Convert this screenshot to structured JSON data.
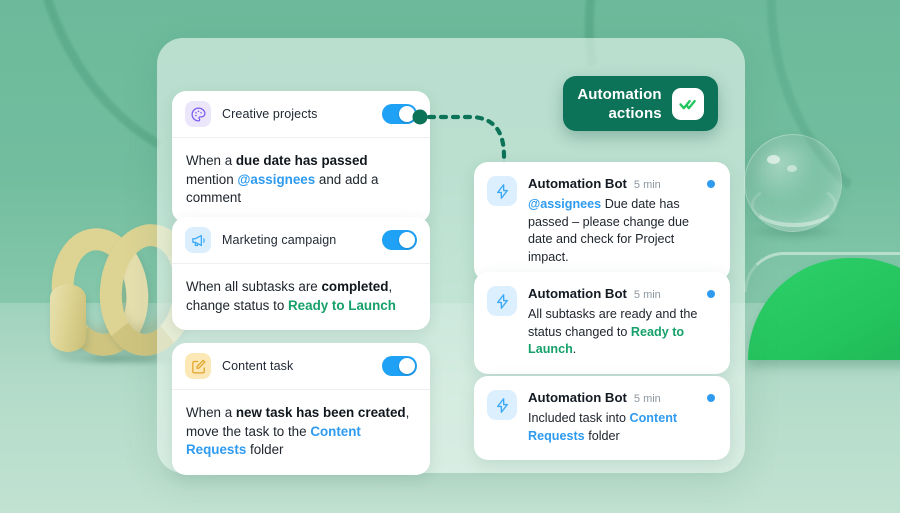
{
  "scene": {
    "background_color": "#6dbb9c",
    "panel_color": "rgba(233,245,239,0.62)"
  },
  "badge": {
    "line1": "Automation",
    "line2": "actions",
    "icon": "double-check-icon",
    "bg_color": "#0d7358",
    "check_color": "#22c55e"
  },
  "connector": {
    "style": "dotted-curve-with-arrow",
    "color": "#0d7358"
  },
  "rules": [
    {
      "id": "creative-projects",
      "title": "Creative projects",
      "icon": "palette-icon",
      "icon_color": "#7c5cf0",
      "icon_bg": "#ece6fb",
      "toggle_on": true,
      "body": {
        "seg1": "When a ",
        "bold1": "due date has passed",
        "seg2": " mention ",
        "link1": "@assignees",
        "seg3": " and add a comment"
      }
    },
    {
      "id": "marketing-campaign",
      "title": "Marketing campaign",
      "icon": "megaphone-icon",
      "icon_color": "#3aa8f5",
      "icon_bg": "#daeefd",
      "toggle_on": true,
      "body": {
        "seg1": "When all subtasks are ",
        "bold1": "completed",
        "seg2": ", change status to ",
        "link1": "Ready to Launch",
        "seg3": ""
      }
    },
    {
      "id": "content-task",
      "title": "Content task",
      "icon": "edit-square-icon",
      "icon_color": "#e0a52b",
      "icon_bg": "#fbe8b6",
      "toggle_on": true,
      "body": {
        "seg1": "When a ",
        "bold1": "new task has been created",
        "seg2": ", move the task to the ",
        "link1": "Content Requests",
        "seg3": " folder"
      }
    }
  ],
  "notifications": [
    {
      "id": "note-due-date",
      "icon": "bolt-icon",
      "sender": "Automation Bot",
      "time": "5 min",
      "unread": true,
      "body": {
        "link1": "@assignees",
        "seg1": " Due date has passed – please change due date and check for Project impact.",
        "link2": "",
        "seg2": ""
      }
    },
    {
      "id": "note-subtasks-ready",
      "icon": "bolt-icon",
      "sender": "Automation Bot",
      "time": "5 min",
      "unread": true,
      "body": {
        "link1": "",
        "seg1": "All subtasks are ready and the status changed to ",
        "link2": "Ready to Launch",
        "seg2": "."
      }
    },
    {
      "id": "note-included-task",
      "icon": "bolt-icon",
      "sender": "Automation Bot",
      "time": "5 min",
      "unread": true,
      "body": {
        "link1": "",
        "seg1": "Included task into ",
        "link2": "Content Requests",
        "seg2": " folder"
      }
    }
  ]
}
